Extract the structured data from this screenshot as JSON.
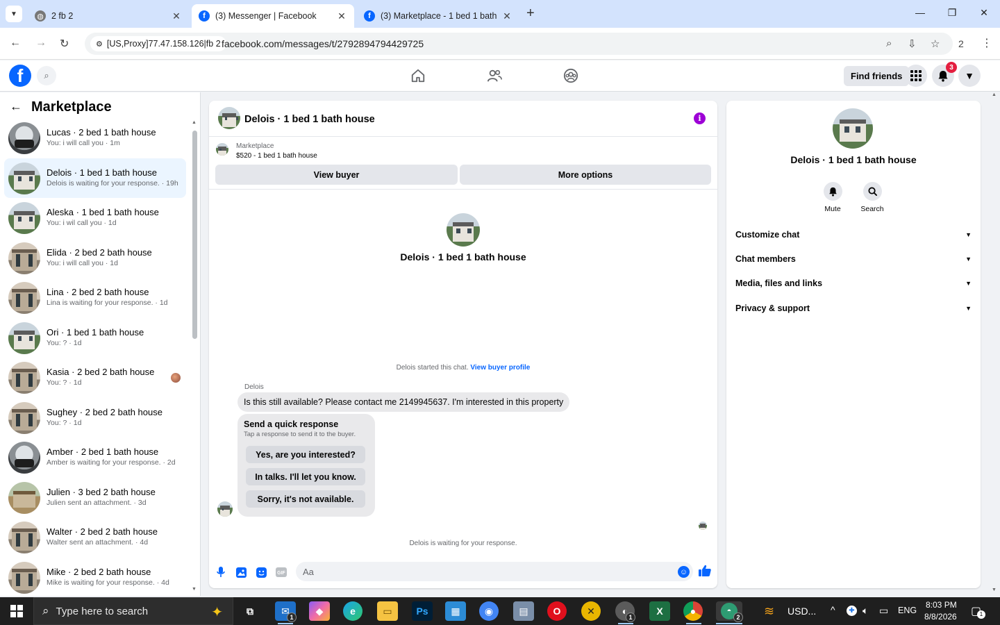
{
  "browser": {
    "tabs": [
      {
        "title": "2 fb 2",
        "active": false
      },
      {
        "title": "(3) Messenger | Facebook",
        "active": true
      },
      {
        "title": "(3) Marketplace - 1 bed 1 bath",
        "active": false
      }
    ],
    "site_chip": "[US,Proxy]77.47.158.126|fb 2",
    "url": "facebook.com/messages/t/2792894794429725",
    "profile_count": "2"
  },
  "fb": {
    "find_friends": "Find friends",
    "notification_count": "3"
  },
  "sidebar": {
    "title": "Marketplace",
    "conversations": [
      {
        "name": "Lucas · 2 bed 1 bath house",
        "snippet": "You: i will call you · 1m",
        "avatar": "h3",
        "active": false,
        "seen": false
      },
      {
        "name": "Delois · 1 bed 1 bath house",
        "snippet": "Delois is waiting for your response. · 19h",
        "avatar": "h1",
        "active": true,
        "seen": false
      },
      {
        "name": "Aleska · 1 bed 1 bath house",
        "snippet": "You: i wil call you · 1d",
        "avatar": "h1",
        "active": false,
        "seen": false
      },
      {
        "name": "Elida · 2 bed 2 bath house",
        "snippet": "You: i will call you · 1d",
        "avatar": "h2",
        "active": false,
        "seen": false
      },
      {
        "name": "Lina · 2 bed 2 bath house",
        "snippet": "Lina is waiting for your response. · 1d",
        "avatar": "h2",
        "active": false,
        "seen": false
      },
      {
        "name": "Ori · 1 bed 1 bath house",
        "snippet": "You: ? · 1d",
        "avatar": "h1",
        "active": false,
        "seen": false
      },
      {
        "name": "Kasia · 2 bed 2 bath house",
        "snippet": "You: ? · 1d",
        "avatar": "h2",
        "active": false,
        "seen": true
      },
      {
        "name": "Sughey · 2 bed 2 bath house",
        "snippet": "You: ? · 1d",
        "avatar": "h2",
        "active": false,
        "seen": false
      },
      {
        "name": "Amber · 2 bed 1 bath house",
        "snippet": "Amber is waiting for your response. · 2d",
        "avatar": "h3",
        "active": false,
        "seen": false
      },
      {
        "name": "Julien · 3 bed 2 bath house",
        "snippet": "Julien sent an attachment. · 3d",
        "avatar": "h4",
        "active": false,
        "seen": false
      },
      {
        "name": "Walter · 2 bed 2 bath house",
        "snippet": "Walter sent an attachment. · 4d",
        "avatar": "h2",
        "active": false,
        "seen": false
      },
      {
        "name": "Mike · 2 bed 2 bath house",
        "snippet": "Mike is waiting for your response. · 4d",
        "avatar": "h2",
        "active": false,
        "seen": false
      }
    ]
  },
  "chat": {
    "title": "Delois · 1 bed 1 bath house",
    "marketplace_label": "Marketplace",
    "listing": "$520 - 1 bed 1 bath house",
    "view_buyer": "View buyer",
    "more_options": "More options",
    "intro_name": "Delois · 1 bed 1 bath house",
    "started_text": "Delois started this chat.",
    "view_buyer_profile": "View buyer profile",
    "sender": "Delois",
    "message": "Is this still available? Please contact me 2149945637. I'm interested in this property",
    "quick_response": {
      "title": "Send a quick response",
      "subtitle": "Tap a response to send it to the buyer.",
      "options": [
        "Yes, are you interested?",
        "In talks. I'll let you know.",
        "Sorry, it's not available."
      ]
    },
    "waiting": "Delois is waiting for your response.",
    "composer_placeholder": "Aa"
  },
  "info": {
    "name": "Delois · 1 bed 1 bath house",
    "actions": [
      {
        "label": "Mute"
      },
      {
        "label": "Search"
      }
    ],
    "sections": [
      "Customize chat",
      "Chat members",
      "Media, files and links",
      "Privacy & support"
    ]
  },
  "taskbar": {
    "search_placeholder": "Type here to search",
    "tray_currency": "USD...",
    "language": "ENG",
    "time": "8:03 PM",
    "date": "8/8/2026",
    "notification_count": "1",
    "app_badges": {
      "mail": "1",
      "browser1": "1",
      "browser2": "2"
    }
  },
  "colors": {
    "accent": "#0866ff",
    "info_icon": "#9d00d6",
    "badge": "#e41e3f"
  }
}
